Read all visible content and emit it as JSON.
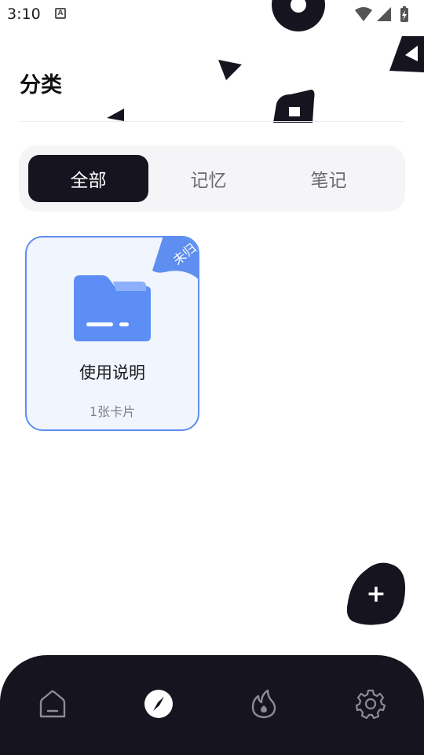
{
  "status_bar": {
    "time": "3:10",
    "notification_glyph": "A",
    "icons": [
      "wifi-icon",
      "signal-icon",
      "battery-icon"
    ]
  },
  "header": {
    "title": "分类"
  },
  "tabs": [
    {
      "label": "全部",
      "active": true
    },
    {
      "label": "记忆",
      "active": false
    },
    {
      "label": "笔记",
      "active": false
    }
  ],
  "categories": [
    {
      "name": "使用说明",
      "count_label": "1张卡片",
      "badge": "未归",
      "icon": "folder-icon"
    }
  ],
  "fab": {
    "label": "+",
    "icon": "plus-icon"
  },
  "bottom_nav": [
    {
      "icon": "home-icon",
      "active": false
    },
    {
      "icon": "compass-icon",
      "active": true
    },
    {
      "icon": "flame-icon",
      "active": false
    },
    {
      "icon": "gear-icon",
      "active": false
    }
  ],
  "colors": {
    "primary_dark": "#16141f",
    "card_border": "#5e8ff0",
    "card_bg": "#f1f5fd",
    "folder_blue": "#5d8ef5",
    "tab_bg": "#f5f5f7"
  }
}
